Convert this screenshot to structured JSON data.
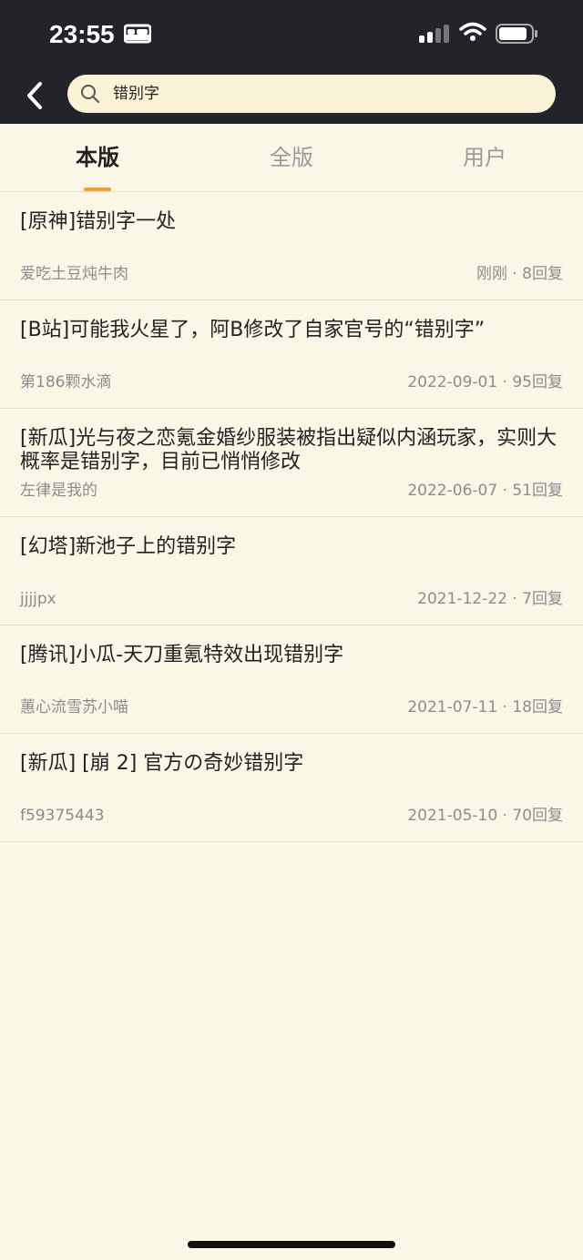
{
  "status": {
    "time": "23:55",
    "icons": [
      "bed-icon",
      "signal-icon",
      "wifi-icon",
      "battery-icon"
    ]
  },
  "nav": {
    "back_icon": "chevron-left-icon",
    "search_value": "错别字"
  },
  "tabs": [
    {
      "label": "本版",
      "active": true
    },
    {
      "label": "全版",
      "active": false
    },
    {
      "label": "用户",
      "active": false
    }
  ],
  "results": [
    {
      "title": "[原神]错别字一处",
      "author": "爱吃土豆炖牛肉",
      "meta": "刚刚 · 8回复"
    },
    {
      "title": "[B站]可能我火星了，阿B修改了自家官号的“错别字”",
      "author": "第186颗水滴",
      "meta": "2022-09-01 · 95回复"
    },
    {
      "title": "[新瓜]光与夜之恋氪金婚纱服装被指出疑似内涵玩家，实则大概率是错别字，目前已悄悄修改",
      "author": "左律是我的",
      "meta": "2022-06-07 · 51回复"
    },
    {
      "title": "[幻塔]新池子上的错别字",
      "author": "jjjjpx",
      "meta": "2021-12-22 · 7回复"
    },
    {
      "title": "[腾讯]小瓜-天刀重氪特效出现错别字",
      "author": "蕙心流雪苏小喵",
      "meta": "2021-07-11 · 18回复"
    },
    {
      "title": "[新瓜] [崩 2] 官方の奇妙错别字",
      "author": "f59375443",
      "meta": "2021-05-10 · 70回复"
    }
  ],
  "colors": {
    "background": "#fbf7e6",
    "header": "#23232a",
    "accent": "#f0a030"
  }
}
